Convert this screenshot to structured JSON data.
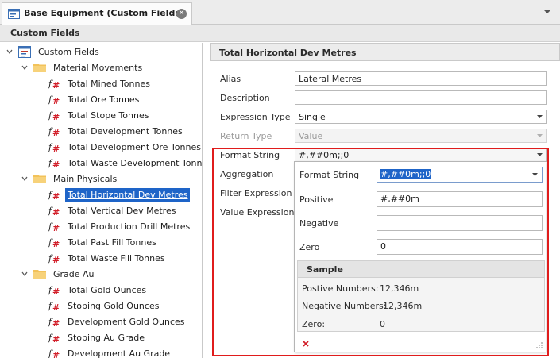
{
  "tab": {
    "title": "Base Equipment (Custom Fields)"
  },
  "section": {
    "title": "Custom Fields"
  },
  "tree": {
    "root": "Custom Fields",
    "groups": [
      {
        "label": "Material Movements",
        "items": [
          "Total Mined Tonnes",
          "Total Ore Tonnes",
          "Total Stope Tonnes",
          "Total Development Tonnes",
          "Total Development Ore Tonnes",
          "Total Waste Development Tonnes"
        ]
      },
      {
        "label": "Main Physicals",
        "items": [
          "Total Horizontal Dev Metres",
          "Total Vertical Dev Metres",
          "Total Production Drill Metres",
          "Total Past Fill Tonnes",
          "Total Waste Fill Tonnes"
        ]
      },
      {
        "label": "Grade Au",
        "items": [
          "Total Gold Ounces",
          "Stoping Gold Ounces",
          "Development Gold Ounces",
          "Stoping Au Grade",
          "Development Au Grade"
        ]
      }
    ]
  },
  "panel": {
    "title": "Total Horizontal Dev Metres",
    "alias_label": "Alias",
    "alias_value": "Lateral Metres",
    "description_label": "Description",
    "description_value": "",
    "expression_type_label": "Expression Type",
    "expression_type_value": "Single",
    "return_type_label": "Return Type",
    "return_type_value": "Value",
    "format_string_label": "Format String",
    "format_string_value": "#,##0m;;0",
    "aggregation_label": "Aggregation",
    "filter_expression_label": "Filter Expression",
    "value_expression_label": "Value Expression"
  },
  "popup": {
    "format_string_label": "Format String",
    "format_string_value": "#,##0m;;0",
    "positive_label": "Positive",
    "positive_value": "#,##0m",
    "negative_label": "Negative",
    "negative_value": "",
    "zero_label": "Zero",
    "zero_value": "0",
    "sample": {
      "title": "Sample",
      "positive_label": "Postive Numbers:",
      "positive_value": "12,346m",
      "negative_label": "Negative Numbers:",
      "negative_value": "-12,346m",
      "zero_label": "Zero:",
      "zero_value": "0"
    },
    "close_glyph": "×"
  },
  "colors": {
    "selection": "#1e64c8",
    "highlight_border": "#e01c1c",
    "folder": "#f2c25a",
    "fx_red": "#d21f2a"
  }
}
